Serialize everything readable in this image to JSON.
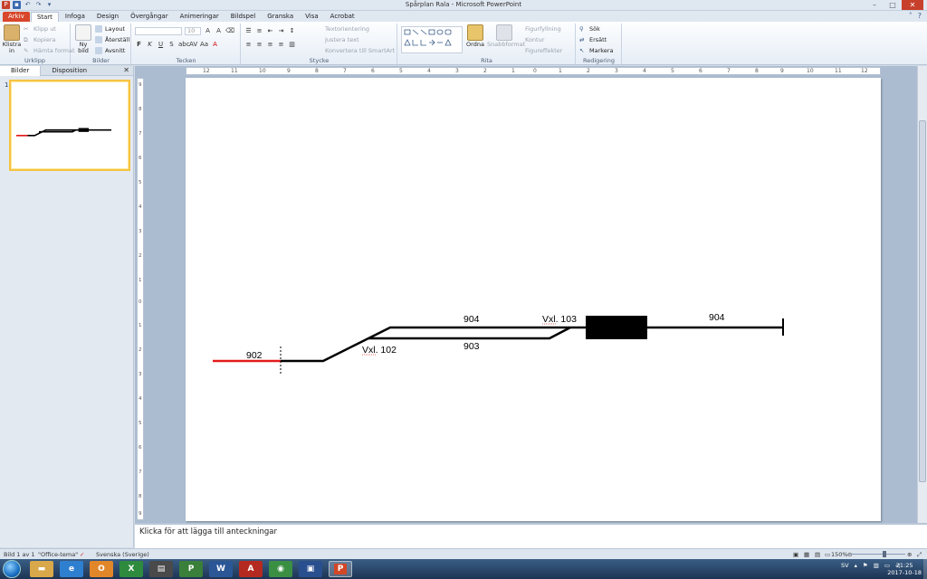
{
  "window": {
    "title": "Spårplan Rala - Microsoft PowerPoint",
    "qat": {
      "save_icon": "save-icon",
      "undo_icon": "undo-icon",
      "redo_icon": "redo-icon"
    },
    "controls": {
      "minimize": "–",
      "maximize": "□",
      "close": "✕"
    }
  },
  "ribbon_tabs": [
    "Arkiv",
    "Start",
    "Infoga",
    "Design",
    "Övergångar",
    "Animeringar",
    "Bildspel",
    "Granska",
    "Visa",
    "Acrobat"
  ],
  "active_tab": "Start",
  "ribbon": {
    "clipboard": {
      "paste": "Klistra in",
      "cut": "Klipp ut",
      "copy": "Kopiera",
      "format_painter": "Hämta format",
      "label": "Urklipp"
    },
    "slides": {
      "new_slide": "Ny bild",
      "layout": "Layout",
      "reset": "Återställ",
      "section": "Avsnitt",
      "label": "Bilder"
    },
    "font": {
      "size": "10",
      "bold": "F",
      "italic": "K",
      "underline": "U",
      "strike": "S",
      "label": "Tecken"
    },
    "paragraph": {
      "text_direction": "Textorientering",
      "align_text": "Justera text",
      "smartart": "Konvertera till SmartArt",
      "label": "Stycke"
    },
    "drawing": {
      "arrange": "Ordna",
      "quick_styles": "Snabbformat",
      "shape_fill": "Figurfyllning",
      "shape_outline": "Kontur",
      "shape_effects": "Figureffekter",
      "label": "Rita"
    },
    "editing": {
      "find": "Sök",
      "replace": "Ersätt",
      "select": "Markera",
      "label": "Redigering"
    }
  },
  "left_panel": {
    "tab_slides": "Bilder",
    "tab_outline": "Disposition",
    "slide_number": "1"
  },
  "h_ruler_ticks": [
    "12",
    "11",
    "10",
    "9",
    "8",
    "7",
    "6",
    "5",
    "4",
    "3",
    "2",
    "1",
    "0",
    "1",
    "2",
    "3",
    "4",
    "5",
    "6",
    "7",
    "8",
    "9",
    "10",
    "11",
    "12"
  ],
  "v_ruler_ticks": [
    "9",
    "8",
    "7",
    "6",
    "5",
    "4",
    "3",
    "2",
    "1",
    "0",
    "1",
    "2",
    "3",
    "4",
    "5",
    "6",
    "7",
    "8",
    "9"
  ],
  "diagram": {
    "label_902": "902",
    "label_904_left": "904",
    "label_904_right": "904",
    "label_903": "903",
    "label_vxl_103": "Vxl. 103",
    "label_vxl_102": "Vxl. 102"
  },
  "notes": {
    "placeholder": "Klicka för att lägga till anteckningar"
  },
  "status": {
    "slide_info": "Bild 1 av 1",
    "theme": "\"Office-tema\"",
    "language": "Svenska (Sverige)",
    "zoom": "150%"
  },
  "taskbar": {
    "language": "SV",
    "time": "21:25",
    "date": "2017-10-18"
  }
}
